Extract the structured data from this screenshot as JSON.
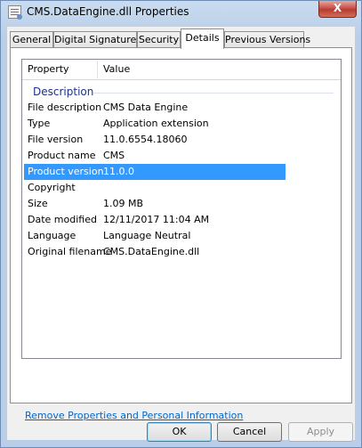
{
  "window": {
    "title": "CMS.DataEngine.dll Properties",
    "close_glyph": "X"
  },
  "tabs": [
    {
      "label": "General"
    },
    {
      "label": "Digital Signatures"
    },
    {
      "label": "Security"
    },
    {
      "label": "Details",
      "active": true
    },
    {
      "label": "Previous Versions"
    }
  ],
  "details": {
    "columns": {
      "property": "Property",
      "value": "Value"
    },
    "group": "Description",
    "rows": [
      {
        "property": "File description",
        "value": "CMS Data Engine"
      },
      {
        "property": "Type",
        "value": "Application extension"
      },
      {
        "property": "File version",
        "value": "11.0.6554.18060"
      },
      {
        "property": "Product name",
        "value": "CMS"
      },
      {
        "property": "Product version",
        "value": "11.0.0",
        "selected": true
      },
      {
        "property": "Copyright",
        "value": ""
      },
      {
        "property": "Size",
        "value": "1.09 MB"
      },
      {
        "property": "Date modified",
        "value": "12/11/2017 11:04 AM"
      },
      {
        "property": "Language",
        "value": "Language Neutral"
      },
      {
        "property": "Original filename",
        "value": "CMS.DataEngine.dll"
      }
    ]
  },
  "link": {
    "label": "Remove Properties and Personal Information"
  },
  "buttons": {
    "ok": "OK",
    "cancel": "Cancel",
    "apply": "Apply"
  },
  "colors": {
    "selection": "#3399ff",
    "group_header": "#1e3287",
    "link": "#0066cc"
  }
}
